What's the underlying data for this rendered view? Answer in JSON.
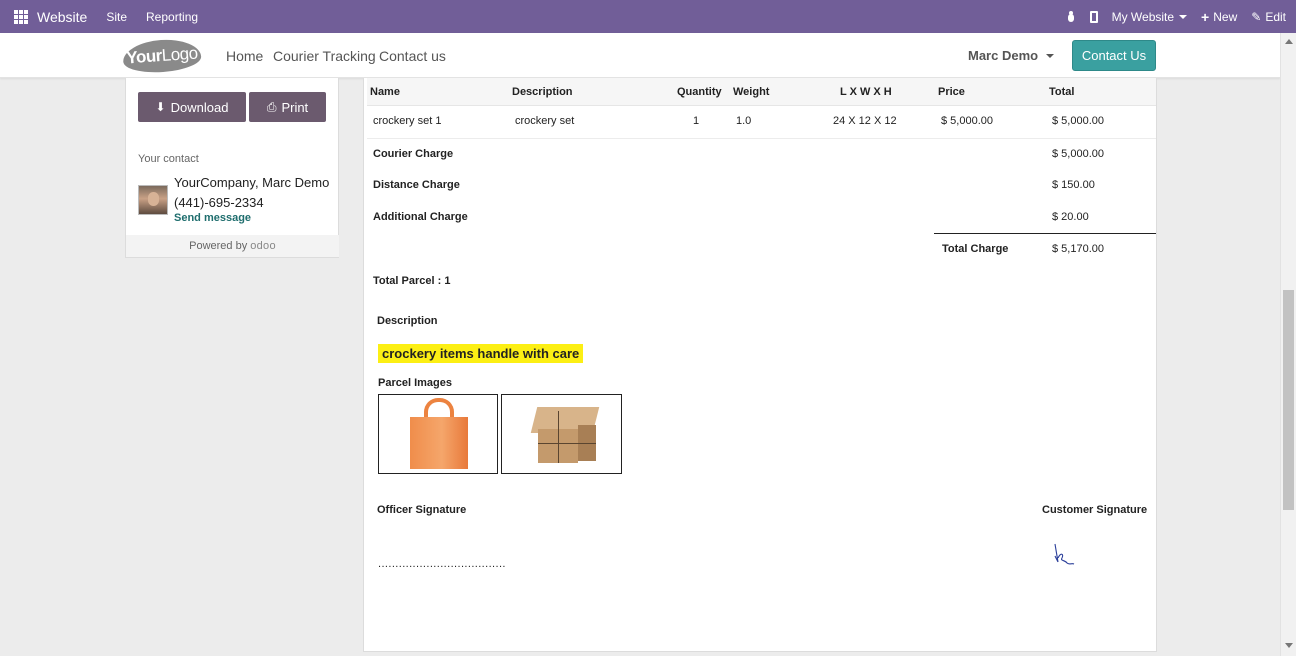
{
  "adminbar": {
    "brand": "Website",
    "menu": [
      "Site",
      "Reporting"
    ],
    "website_selector": "My Website",
    "new_label": "New",
    "edit_label": "Edit",
    "color": "#715e98"
  },
  "header": {
    "logo_bold": "Your",
    "logo_thin": "Logo",
    "nav": [
      "Home",
      "Courier Tracking",
      "Contact us"
    ],
    "user": "Marc Demo",
    "cta": "Contact Us"
  },
  "sidebar": {
    "download_label": "Download",
    "print_label": "Print",
    "your_contact_label": "Your contact",
    "company": "YourCompany, Marc Demo",
    "phone": "(441)-695-2334",
    "send_message": "Send message",
    "powered_by": "Powered by",
    "powered_brand": "odoo"
  },
  "table": {
    "columns": [
      "Name",
      "Description",
      "Quantity",
      "Weight",
      "L X W X H",
      "Price",
      "Total"
    ],
    "rows": [
      {
        "name": "crockery set 1",
        "description": "crockery set",
        "quantity": "1",
        "weight": "1.0",
        "dimensions": "24 X 12 X 12",
        "price": "$ 5,000.00",
        "total": "$ 5,000.00"
      }
    ]
  },
  "charges": {
    "courier_label": "Courier Charge",
    "courier_value": "$ 5,000.00",
    "distance_label": "Distance Charge",
    "distance_value": "$ 150.00",
    "additional_label": "Additional Charge",
    "additional_value": "$ 20.00",
    "total_label": "Total Charge",
    "total_value": "$ 5,170.00"
  },
  "parcel": {
    "total_parcel": "Total Parcel : 1",
    "description_label": "Description",
    "description_text": "crockery items handle with care",
    "images_label": "Parcel Images",
    "images": [
      "orange-bag-image",
      "brown-parcel-image"
    ]
  },
  "signatures": {
    "officer_label": "Officer Signature",
    "officer_line": ".....................................",
    "customer_label": "Customer Signature"
  }
}
